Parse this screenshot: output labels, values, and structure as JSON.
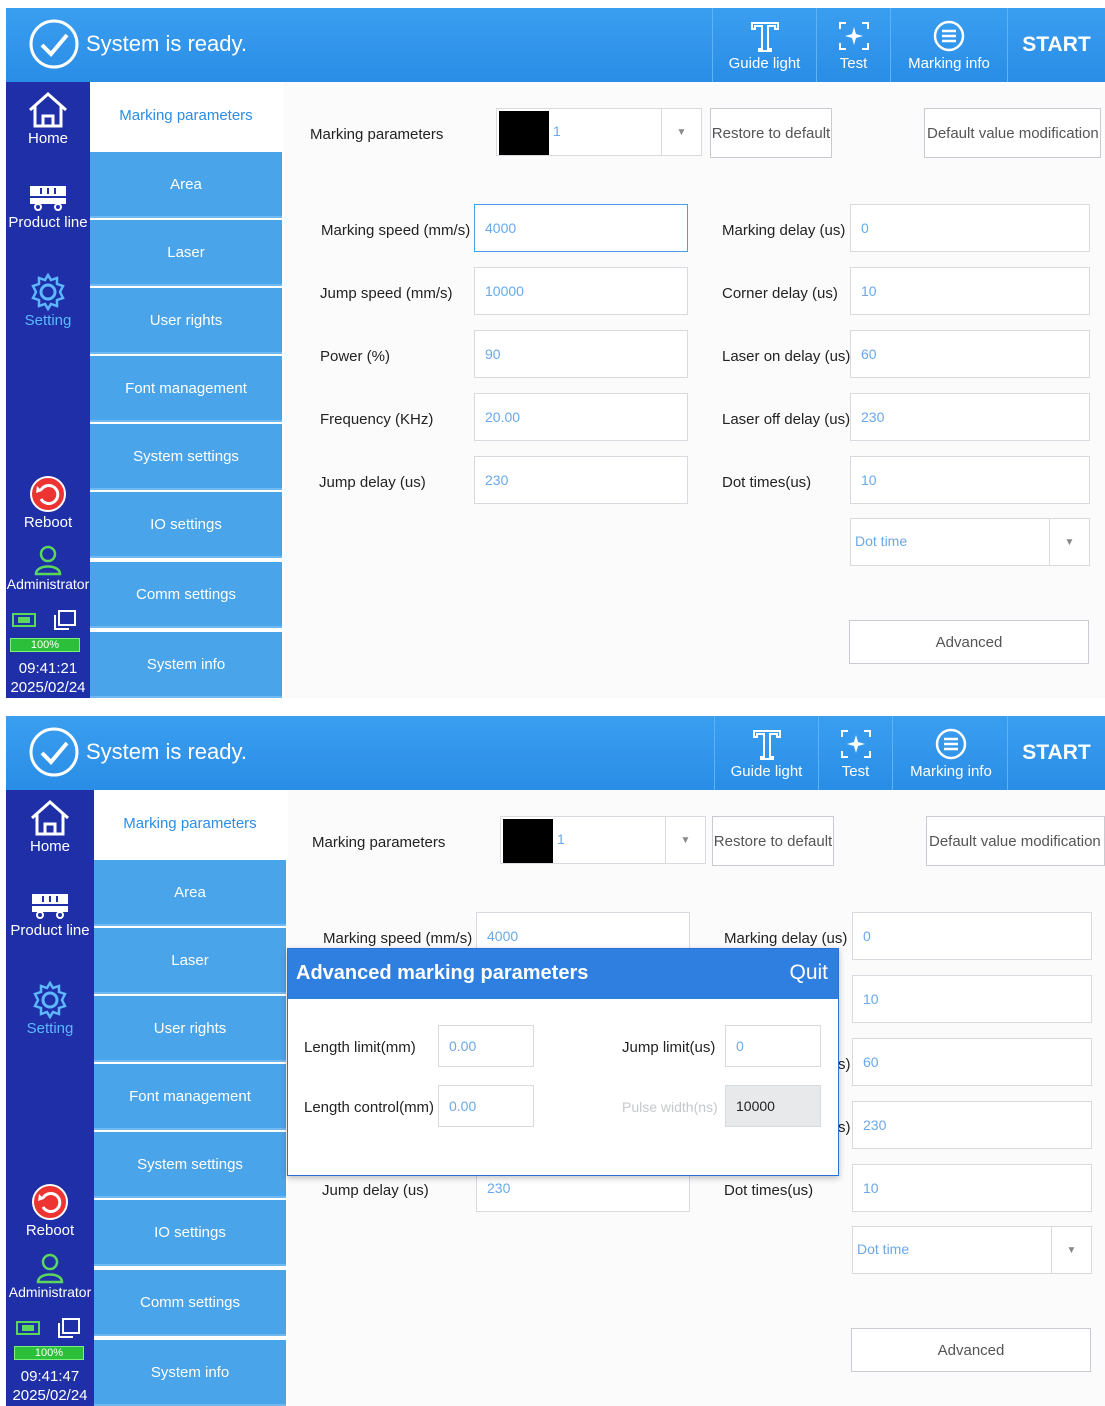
{
  "screens": [
    {
      "topbar": {
        "status": "System is ready.",
        "guide_light": "Guide light",
        "test": "Test",
        "marking_info": "Marking info",
        "start": "START"
      },
      "leftnav": {
        "home": "Home",
        "product_line": "Product line",
        "setting": "Setting",
        "reboot": "Reboot",
        "administrator": "Administrator",
        "battery": "100%",
        "time": "09:41:21",
        "date": "2025/02/24"
      },
      "submenu": [
        "Marking parameters",
        "Area",
        "Laser",
        "User rights",
        "Font management",
        "System settings",
        "IO settings",
        "Comm settings",
        "System info"
      ],
      "main": {
        "params_label": "Marking parameters",
        "params_value": "1",
        "restore": "Restore to default",
        "default_mod": "Default value modification",
        "left_labels": [
          "Marking speed (mm/s)",
          "Jump speed (mm/s)",
          "Power (%)",
          "Frequency (KHz)",
          "Jump delay (us)"
        ],
        "left_values": [
          "4000",
          "10000",
          "90",
          "20.00",
          "230"
        ],
        "right_labels": [
          "Marking delay (us)",
          "Corner delay (us)",
          "Laser on delay (us)",
          "Laser off delay (us)",
          "Dot times(us)"
        ],
        "right_values": [
          "0",
          "10",
          "60",
          "230",
          "10"
        ],
        "dot_time": "Dot time",
        "advanced": "Advanced"
      }
    },
    {
      "topbar": {
        "status": "System is ready.",
        "guide_light": "Guide light",
        "test": "Test",
        "marking_info": "Marking info",
        "start": "START"
      },
      "leftnav": {
        "home": "Home",
        "product_line": "Product line",
        "setting": "Setting",
        "reboot": "Reboot",
        "administrator": "Administrator",
        "battery": "100%",
        "time": "09:41:47",
        "date": "2025/02/24"
      },
      "submenu": [
        "Marking parameters",
        "Area",
        "Laser",
        "User rights",
        "Font management",
        "System settings",
        "IO settings",
        "Comm settings",
        "System info"
      ],
      "main": {
        "params_label": "Marking parameters",
        "params_value": "1",
        "restore": "Restore to default",
        "default_mod": "Default value modification",
        "left_labels": [
          "Marking speed (mm/s)",
          "",
          "",
          "",
          "Jump delay (us)"
        ],
        "left_values": [
          "4000",
          "",
          "",
          "",
          "230"
        ],
        "right_labels": [
          "Marking delay (us)",
          "",
          "s)",
          "s)",
          "Dot times(us)"
        ],
        "right_values": [
          "0",
          "10",
          "60",
          "230",
          "10"
        ],
        "dot_time": "Dot time",
        "advanced": "Advanced"
      },
      "dialog": {
        "title": "Advanced marking parameters",
        "quit": "Quit",
        "length_limit_label": "Length limit(mm)",
        "length_limit": "0.00",
        "jump_limit_label": "Jump limit(us)",
        "jump_limit": "0",
        "length_control_label": "Length control(mm)",
        "length_control": "0.00",
        "pulse_width_label": "Pulse width(ns)",
        "pulse_width": "10000"
      }
    }
  ]
}
